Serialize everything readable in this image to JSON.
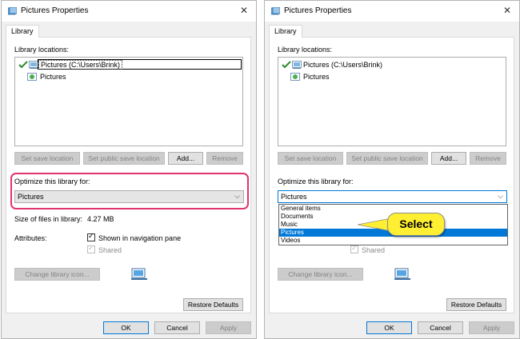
{
  "left": {
    "title": "Pictures Properties",
    "close": "✕",
    "tab": "Library",
    "library_locations_label": "Library locations:",
    "locations": [
      {
        "label": "Pictures (C:\\Users\\Brink)"
      },
      {
        "label": "Pictures"
      }
    ],
    "buttons": {
      "set_save": "Set save location",
      "set_public": "Set public save location",
      "add": "Add...",
      "remove": "Remove"
    },
    "optimize_label": "Optimize this library for:",
    "optimize_value": "Pictures",
    "combo_arrow": "⌵",
    "size_label": "Size of files in library:",
    "size_value": "4.27 MB",
    "attributes_label": "Attributes:",
    "show_in_nav": "Shown in navigation pane",
    "shared": "Shared",
    "change_icon": "Change library icon...",
    "restore_defaults": "Restore Defaults",
    "ok": "OK",
    "cancel": "Cancel",
    "apply": "Apply"
  },
  "right": {
    "title": "Pictures Properties",
    "close": "✕",
    "tab": "Library",
    "library_locations_label": "Library locations:",
    "locations": [
      {
        "label": "Pictures (C:\\Users\\Brink)"
      },
      {
        "label": "Pictures"
      }
    ],
    "buttons": {
      "set_save": "Set save location",
      "set_public": "Set public save location",
      "add": "Add...",
      "remove": "Remove"
    },
    "optimize_label": "Optimize this library for:",
    "optimize_value": "Pictures",
    "combo_arrow": "⌵",
    "dropdown_options": [
      "General items",
      "Documents",
      "Music",
      "Pictures",
      "Videos"
    ],
    "selected_option": "Pictures",
    "shared": "Shared",
    "change_icon": "Change library icon...",
    "restore_defaults": "Restore Defaults",
    "ok": "OK",
    "cancel": "Cancel",
    "apply": "Apply",
    "callout": "Select"
  },
  "colors": {
    "highlight": "#e0336f",
    "accent": "#0078d7",
    "callout_bg": "#ffef33"
  }
}
